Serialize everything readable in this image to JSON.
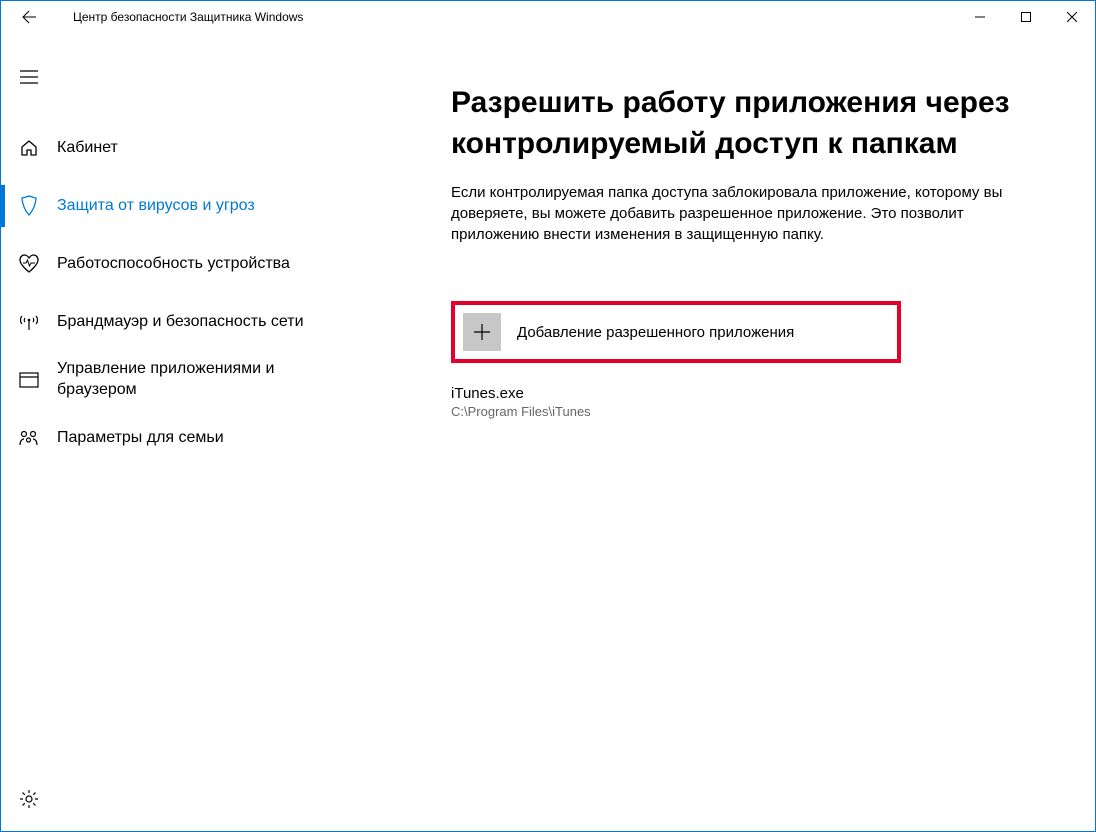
{
  "window": {
    "title": "Центр безопасности Защитника Windows"
  },
  "sidebar": {
    "items": [
      {
        "label": "Кабинет"
      },
      {
        "label": "Защита от вирусов и угроз"
      },
      {
        "label": "Работоспособность устройства"
      },
      {
        "label": "Брандмауэр и безопасность сети"
      },
      {
        "label": "Управление приложениями и браузером"
      },
      {
        "label": "Параметры для семьи"
      }
    ]
  },
  "main": {
    "title": "Разрешить работу приложения через контролируемый доступ к папкам",
    "description": "Если контролируемая папка доступа заблокировала приложение, которому вы доверяете, вы можете добавить разрешенное приложение. Это позволит приложению внести изменения в защищенную папку.",
    "add_button_label": "Добавление разрешенного приложения",
    "app": {
      "name": "iTunes.exe",
      "path": "C:\\Program Files\\iTunes"
    }
  }
}
